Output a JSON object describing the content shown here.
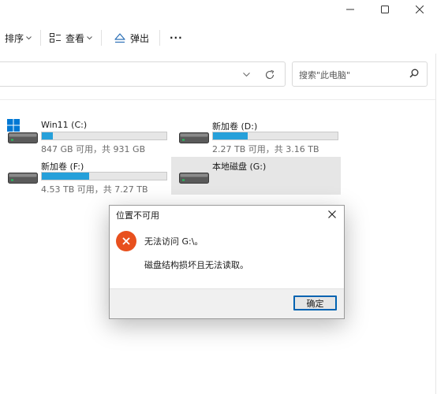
{
  "toolbar": {
    "sort_label": "排序",
    "view_label": "查看",
    "eject_label": "弹出",
    "more_label": "···"
  },
  "address": {
    "search_placeholder": "搜索\"此电脑\""
  },
  "drives": [
    {
      "name": "Win11 (C:)",
      "info": "847 GB 可用，共 931 GB",
      "used_fraction": 0.09
    },
    {
      "name": "新加卷 (D:)",
      "info": "2.27 TB 可用，共 3.16 TB",
      "used_fraction": 0.28
    },
    {
      "name": "新加卷 (F:)",
      "info": "4.53 TB 可用，共 7.27 TB",
      "used_fraction": 0.38
    },
    {
      "name": "本地磁盘 (G:)"
    }
  ],
  "dialog": {
    "title": "位置不可用",
    "message_line1": "无法访问 G:\\。",
    "message_line2": "磁盘结构损坏且无法读取。",
    "ok_label": "确定"
  },
  "colors": {
    "accent": "#26a0da",
    "error": "#e8501e",
    "button_border": "#0063b1"
  }
}
